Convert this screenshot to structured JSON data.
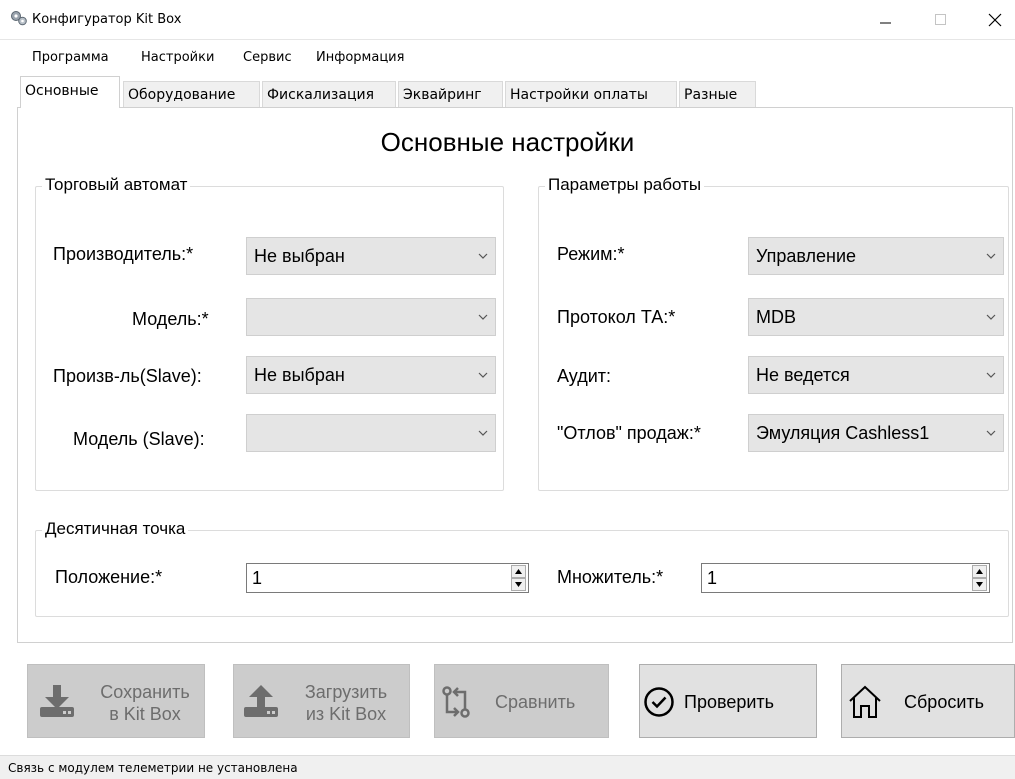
{
  "window": {
    "title": "Конфигуратор Kit Box"
  },
  "menu": [
    "Программа",
    "Настройки",
    "Сервис",
    "Информация"
  ],
  "tabs": [
    "Основные",
    "Оборудование",
    "Фискализация",
    "Эквайринг",
    "Настройки оплаты",
    "Разные"
  ],
  "page_title": "Основные настройки",
  "vending": {
    "title": "Торговый автомат",
    "manufacturer": {
      "label": "Производитель:*",
      "value": "Не выбран"
    },
    "model": {
      "label": "Модель:*",
      "value": ""
    },
    "manufacturer_slave": {
      "label": "Произв-ль(Slave):",
      "value": "Не выбран"
    },
    "model_slave": {
      "label": "Модель (Slave):",
      "value": ""
    }
  },
  "params": {
    "title": "Параметры работы",
    "mode": {
      "label": "Режим:*",
      "value": "Управление"
    },
    "protocol": {
      "label": "Протокол ТА:*",
      "value": "MDB"
    },
    "audit": {
      "label": "Аудит:",
      "value": "Не ведется"
    },
    "sales_capture": {
      "label": "\"Отлов\" продаж:*",
      "value": "Эмуляция Cashless1"
    }
  },
  "decimal": {
    "title": "Десятичная точка",
    "position": {
      "label": "Положение:*",
      "value": "1"
    },
    "multiplier": {
      "label": "Множитель:*",
      "value": "1"
    }
  },
  "actions": {
    "save": {
      "line1": "Сохранить",
      "line2": "в Kit Box",
      "icon": "download-icon",
      "enabled": false
    },
    "load": {
      "line1": "Загрузить",
      "line2": "из Kit Box",
      "icon": "upload-icon",
      "enabled": false
    },
    "compare": {
      "label": "Сравнить",
      "icon": "compare-icon",
      "enabled": false
    },
    "check": {
      "label": "Проверить",
      "icon": "check-circle-icon",
      "enabled": true
    },
    "reset": {
      "label": "Сбросить",
      "icon": "home-icon",
      "enabled": true
    }
  },
  "status": "Связь с модулем телеметрии не установлена"
}
